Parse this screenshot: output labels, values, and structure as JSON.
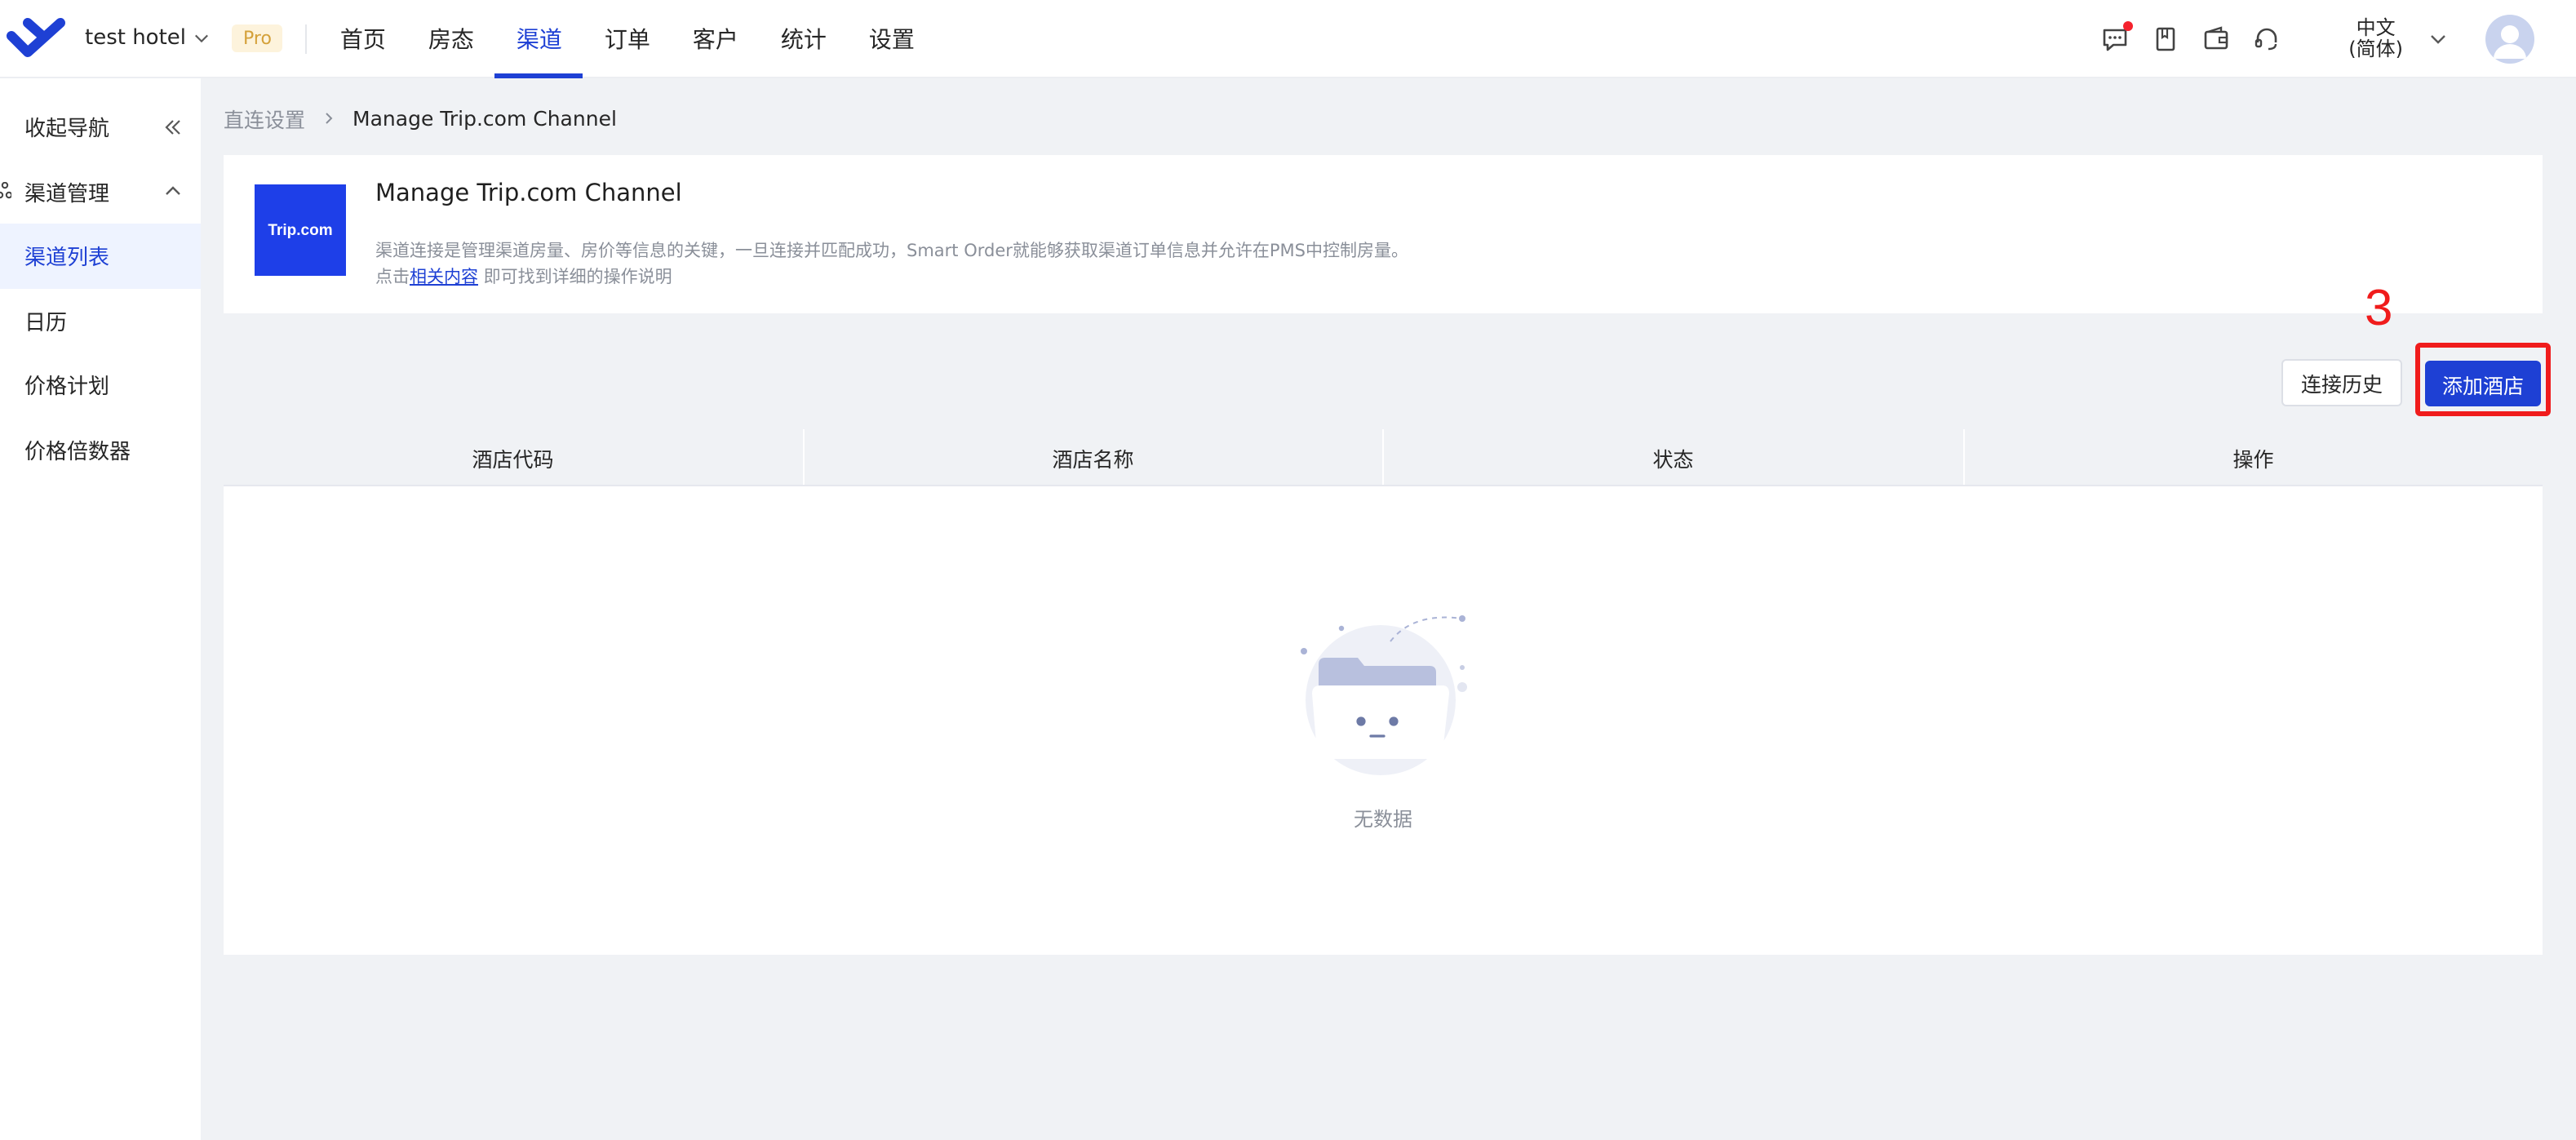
{
  "header": {
    "hotel_name": "test hotel",
    "plan_badge": "Pro",
    "nav": [
      {
        "label": "首页",
        "active": false
      },
      {
        "label": "房态",
        "active": false
      },
      {
        "label": "渠道",
        "active": true
      },
      {
        "label": "订单",
        "active": false
      },
      {
        "label": "客户",
        "active": false
      },
      {
        "label": "统计",
        "active": false
      },
      {
        "label": "设置",
        "active": false
      }
    ],
    "tools": [
      "message-icon",
      "book-icon",
      "wallet-icon",
      "headset-icon"
    ],
    "language_line1": "中文",
    "language_line2": "(简体)"
  },
  "sidebar": {
    "collapse_label": "收起导航",
    "group_label": "渠道管理",
    "items": [
      {
        "label": "渠道列表",
        "active": true
      },
      {
        "label": "日历",
        "active": false
      },
      {
        "label": "价格计划",
        "active": false
      },
      {
        "label": "价格倍数器",
        "active": false
      }
    ]
  },
  "breadcrumb": {
    "parent": "直连设置",
    "current": "Manage Trip.com Channel"
  },
  "intro": {
    "logo_text": "Trip.com",
    "title": "Manage Trip.com Channel",
    "description": "渠道连接是管理渠道房量、房价等信息的关键，一旦连接并匹配成功，Smart Order就能够获取渠道订单信息并允许在PMS中控制房量。",
    "help_prefix": "点击",
    "help_link": "相关内容",
    "help_suffix": " 即可找到详细的操作说明"
  },
  "annotation": {
    "step_number": "3"
  },
  "actions": {
    "history_label": "连接历史",
    "add_hotel_label": "添加酒店"
  },
  "table": {
    "columns": [
      "酒店代码",
      "酒店名称",
      "状态",
      "操作"
    ],
    "rows": [],
    "empty_text": "无数据"
  },
  "colors": {
    "primary": "#1e40d4",
    "highlight": "#f01c1c",
    "trip_brand": "#1e3fe8",
    "page_bg": "#f0f2f5"
  }
}
